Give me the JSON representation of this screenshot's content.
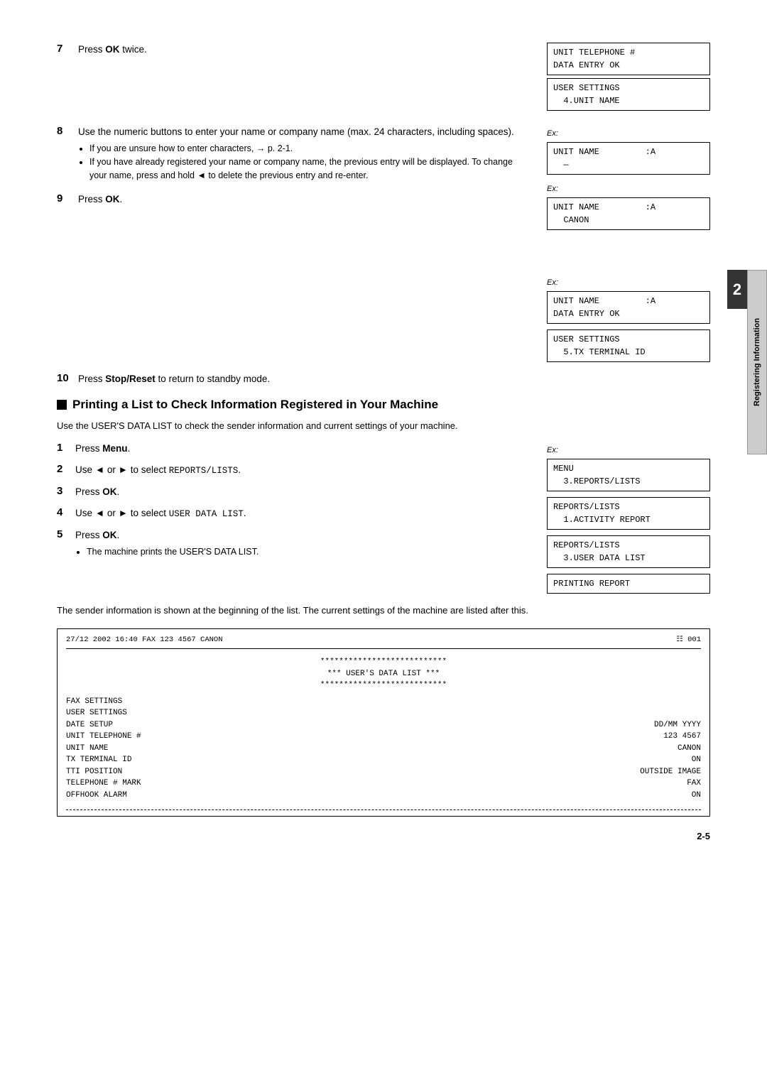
{
  "page": {
    "side_tab_text": "Registering Information",
    "section_number": "2",
    "page_number": "2-5"
  },
  "step7": {
    "num": "7",
    "text": "Press ",
    "bold": "OK",
    "text2": " twice.",
    "lcd1_line1": "UNIT TELEPHONE #",
    "lcd1_line2": "DATA ENTRY OK",
    "lcd2_line1": "USER SETTINGS",
    "lcd2_line2": "  4.UNIT NAME"
  },
  "step8": {
    "num": "8",
    "text": "Use the numeric buttons to enter your name or company name (max. 24 characters, including spaces).",
    "bullet1": "If you are unsure how to enter characters, → p. 2-1.",
    "bullet2": "If you have already registered your name or company name, the previous entry will be displayed. To change your name, press and hold ◄ to delete the previous entry and re-enter.",
    "ex_label1": "Ex:",
    "lcd3_line1": "UNIT NAME         :A",
    "lcd3_line2": "  —",
    "ex_label2": "Ex:",
    "lcd4_line1": "UNIT NAME         :A",
    "lcd4_line2": "  CANON"
  },
  "step9": {
    "num": "9",
    "text": "Press ",
    "bold": "OK",
    "text2": ".",
    "ex_label": "Ex:",
    "lcd5_line1": "UNIT NAME         :A",
    "lcd5_line2": "DATA ENTRY OK",
    "lcd6_line1": "USER SETTINGS",
    "lcd6_line2": "  5.TX TERMINAL ID"
  },
  "step10": {
    "num": "10",
    "text": "Press ",
    "bold": "Stop/Reset",
    "text2": " to return to standby mode."
  },
  "printing_section": {
    "heading": "Printing a List to Check Information Registered in Your Machine",
    "desc": "Use the USER'S DATA LIST to check the sender information and current settings of your machine.",
    "step1": {
      "num": "1",
      "text": "Press ",
      "bold": "Menu",
      "text2": "."
    },
    "step2": {
      "num": "2",
      "text": "Use ◄ or ► to select ",
      "code": "REPORTS/LISTS",
      "text2": ".",
      "ex_label": "Ex:",
      "lcd_line1": "MENU",
      "lcd_line2": "  3.REPORTS/LISTS"
    },
    "step3": {
      "num": "3",
      "text": "Press ",
      "bold": "OK",
      "text2": ".",
      "lcd_line1": "REPORTS/LISTS",
      "lcd_line2": "  1.ACTIVITY REPORT"
    },
    "step4": {
      "num": "4",
      "text": "Use ◄ or ► to select ",
      "code": "USER DATA LIST",
      "text2": ".",
      "lcd_line1": "REPORTS/LISTS",
      "lcd_line2": "  3.USER DATA LIST"
    },
    "step5": {
      "num": "5",
      "text": "Press ",
      "bold": "OK",
      "text2": ".",
      "bullet": "The machine prints the USER'S DATA LIST.",
      "lcd_line1": "PRINTING REPORT"
    }
  },
  "sender_info_text": "The sender information is shown at the beginning of the list. The current settings of the machine are listed after this.",
  "data_list": {
    "header_left": "27/12 2002 16:40 FAX 123 4567     CANON",
    "header_right": "001",
    "stars1": "***************************",
    "title": "***   USER'S DATA LIST   ***",
    "stars2": "***************************",
    "fax_settings": "FAX SETTINGS",
    "user_settings": "   USER SETTINGS",
    "date_setup_label": "      DATE SETUP",
    "date_setup_value": "DD/MM YYYY",
    "unit_tel_label": "      UNIT TELEPHONE #",
    "unit_tel_value": "123 4567",
    "unit_name_label": "      UNIT NAME",
    "unit_name_value": "CANON",
    "tx_terminal_label": "      TX TERMINAL ID",
    "tx_terminal_value": "ON",
    "tti_position_label": "         TTI POSITION",
    "tti_position_value": "OUTSIDE IMAGE",
    "tel_mark_label": "         TELEPHONE # MARK",
    "tel_mark_value": "FAX",
    "offhook_label": "      OFFHOOK ALARM",
    "offhook_value": "ON"
  }
}
